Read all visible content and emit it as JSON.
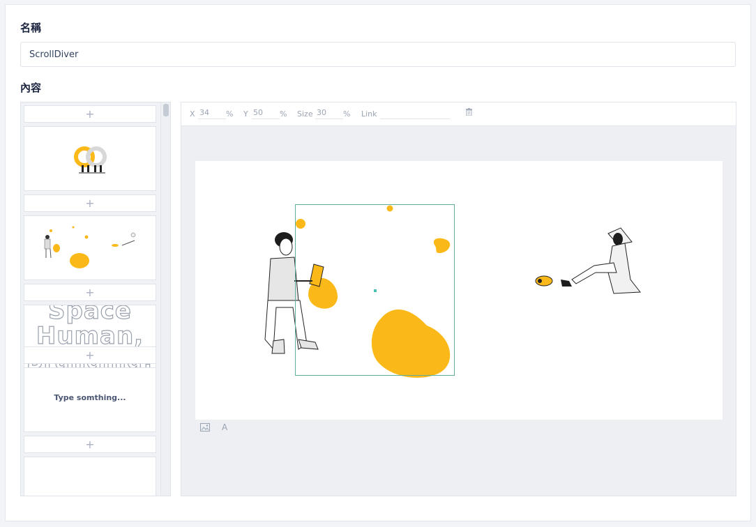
{
  "form": {
    "name_label": "名稱",
    "name_value": "ScrollDiver",
    "content_label": "內容"
  },
  "list": {
    "add_symbol": "+",
    "thumb_text": "Type somthing...",
    "space_lines": [
      "Space",
      "Human,",
      "Branding!"
    ]
  },
  "toolbar": {
    "x_label": "X",
    "x_value": "34",
    "x_unit": "%",
    "y_label": "Y",
    "y_value": "50",
    "y_unit": "%",
    "size_label": "Size",
    "size_value": "30",
    "size_unit": "%",
    "link_label": "Link",
    "link_value": "",
    "delete_icon": "trash-icon"
  },
  "bottom_tools": {
    "image_icon": "image-icon",
    "text_tool": "A"
  },
  "colors": {
    "accent_yellow": "#fbb919",
    "selection": "#5fae9c"
  }
}
